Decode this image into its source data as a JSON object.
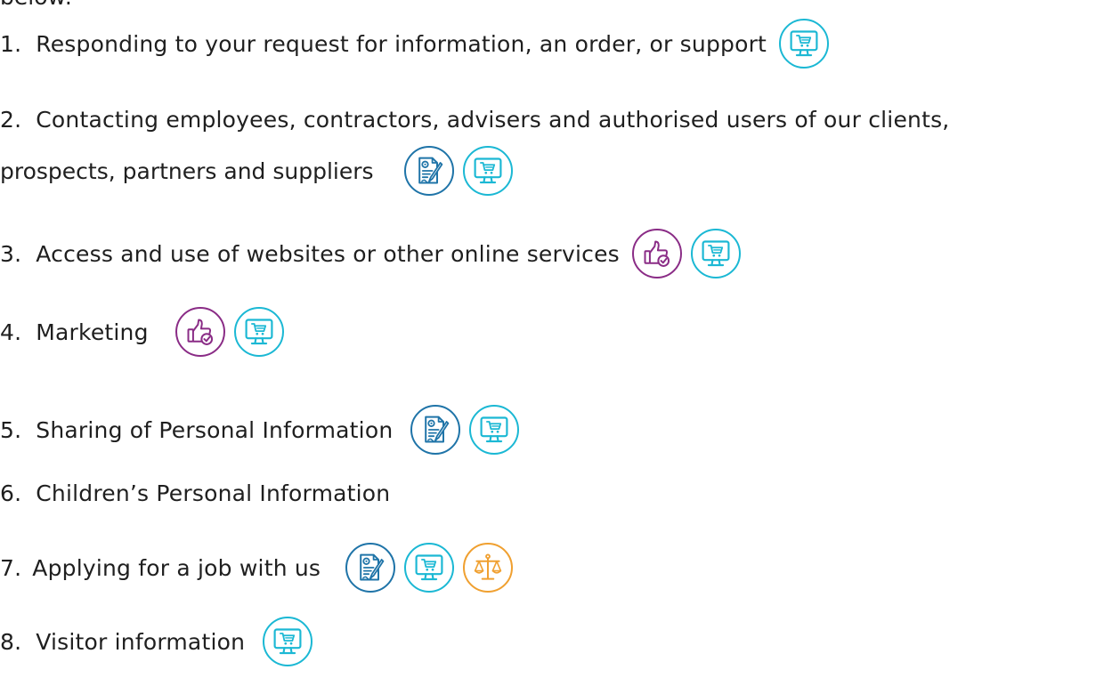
{
  "intro_fragment": "below:",
  "items": [
    {
      "num": "1.",
      "text": "Responding to your request for information, an order, or support",
      "icons": [
        "shopping-cart-monitor-icon"
      ]
    },
    {
      "num": "2.",
      "text": "Contacting employees, contractors, advisers and authorised users of our clients,",
      "text2": "prospects, partners and suppliers",
      "icons": [
        "contract-document-icon",
        "shopping-cart-monitor-icon"
      ]
    },
    {
      "num": "3.",
      "text": "Access and use of websites or other online services",
      "icons": [
        "thumbs-up-consent-icon",
        "shopping-cart-monitor-icon"
      ]
    },
    {
      "num": "4.",
      "text": "Marketing",
      "icons": [
        "thumbs-up-consent-icon",
        "shopping-cart-monitor-icon"
      ]
    },
    {
      "num": "5.",
      "text": "Sharing of Personal Information",
      "icons": [
        "contract-document-icon",
        "shopping-cart-monitor-icon"
      ]
    },
    {
      "num": "6.",
      "text": "Children’s Personal Information",
      "icons": []
    },
    {
      "num": "7.",
      "text": "Applying for a job with us",
      "icons": [
        "contract-document-icon",
        "shopping-cart-monitor-icon",
        "legal-scales-icon"
      ]
    },
    {
      "num": "8.",
      "text": "Visitor information",
      "icons": [
        "shopping-cart-monitor-icon"
      ]
    }
  ],
  "colors": {
    "text": "#1f1f1f",
    "teal": "#1bb8d4",
    "blue": "#1f74a8",
    "purple": "#8a2c86",
    "orange": "#f0a030"
  }
}
